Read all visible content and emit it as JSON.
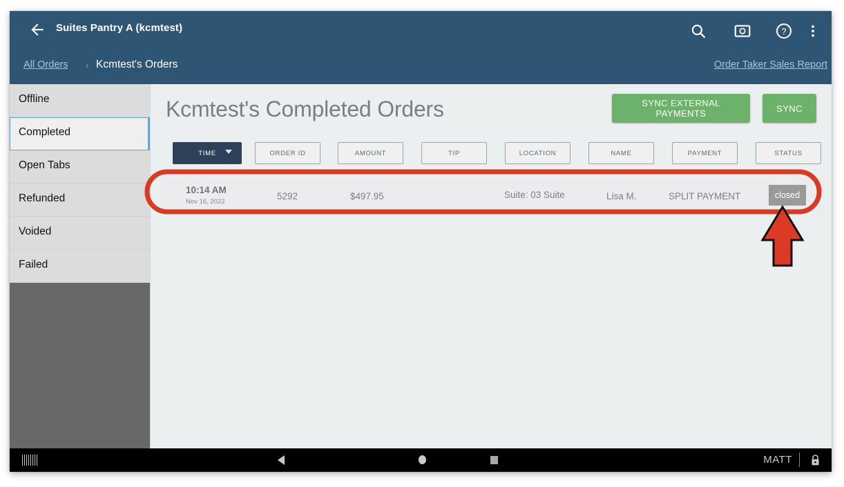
{
  "appbar": {
    "back_icon": "back-arrow-icon",
    "title": "Suites Pantry A (kcmtest)",
    "icons": [
      {
        "name": "search-icon",
        "label": "Search"
      },
      {
        "name": "camera-icon",
        "label": "Screenshot"
      },
      {
        "name": "help-icon",
        "label": "Help"
      },
      {
        "name": "overflow-menu-icon",
        "label": "More options"
      }
    ]
  },
  "breadcrumb": {
    "root": "All Orders",
    "separator": "›",
    "current": "Kcmtest's Orders",
    "report_link": "Order Taker Sales Report"
  },
  "sidebar": {
    "items": [
      {
        "label": "Offline",
        "selected": false
      },
      {
        "label": "Completed",
        "selected": true
      },
      {
        "label": "Open Tabs",
        "selected": false
      },
      {
        "label": "Refunded",
        "selected": false
      },
      {
        "label": "Voided",
        "selected": false
      },
      {
        "label": "Failed",
        "selected": false
      }
    ]
  },
  "main": {
    "page_title": "Kcmtest's Completed Orders",
    "sync_external_label": "SYNC EXTERNAL PAYMENTS",
    "sync_label": "SYNC",
    "columns": [
      {
        "label": "TIME",
        "active": true,
        "sort_caret": true
      },
      {
        "label": "ORDER ID",
        "active": false,
        "sort_caret": false
      },
      {
        "label": "AMOUNT",
        "active": false,
        "sort_caret": false
      },
      {
        "label": "TIP",
        "active": false,
        "sort_caret": false
      },
      {
        "label": "LOCATION",
        "active": false,
        "sort_caret": false
      },
      {
        "label": "NAME",
        "active": false,
        "sort_caret": false
      },
      {
        "label": "PAYMENT",
        "active": false,
        "sort_caret": false
      },
      {
        "label": "STATUS",
        "active": false,
        "sort_caret": false
      }
    ],
    "rows": [
      {
        "time": "10:14 AM",
        "date": "Nov 16, 2022",
        "order_id": "5292",
        "amount": "$497.95",
        "tip": "",
        "location": "Suite: 03 Suite",
        "name": "Lisa M.",
        "payment": "SPLIT PAYMENT",
        "status": "closed"
      }
    ]
  },
  "navbar": {
    "back_label": "Back",
    "home_label": "Home",
    "recent_label": "Recent apps",
    "user": "MATT",
    "lock_label": "Lock"
  },
  "annotation": {
    "ellipse_color": "#D63B26",
    "arrow_color": "#DC3A26",
    "arrow_outline": "#111111"
  },
  "colors": {
    "appbar_blue": "#2e5674",
    "sync_green": "#6cb26a",
    "column_active": "#2f4158",
    "status_badge_gray": "#9a9a9a",
    "sidebar_item_gray": "#dcdcdc",
    "sidebar_empty_gray": "#686868",
    "content_bg": "#eceff0"
  }
}
